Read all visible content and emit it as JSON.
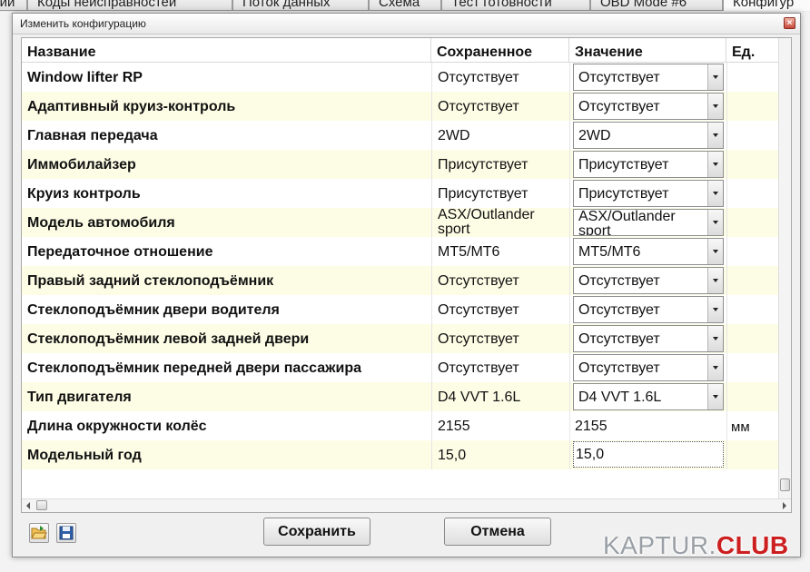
{
  "background_tabs": [
    "ции",
    "Коды неисправностей",
    "Поток данных",
    "Схема",
    "Тест готовности",
    "OBD Mode #6",
    "Конфигур"
  ],
  "dialog": {
    "title": "Изменить конфигурацию",
    "close_symbol": "×"
  },
  "table": {
    "columns": [
      "Название",
      "Сохраненное",
      "Значение",
      "Ед."
    ],
    "rows": [
      {
        "name": "Window lifter RP",
        "saved": "Отсутствует",
        "value": "Отсутствует",
        "unit": ""
      },
      {
        "name": "Адаптивный круиз-контроль",
        "saved": "Отсутствует",
        "value": "Отсутствует",
        "unit": ""
      },
      {
        "name": "Главная передача",
        "saved": "2WD",
        "value": "2WD",
        "unit": ""
      },
      {
        "name": "Иммобилайзер",
        "saved": "Присутствует",
        "value": "Присутствует",
        "unit": ""
      },
      {
        "name": "Круиз контроль",
        "saved": "Присутствует",
        "value": "Присутствует",
        "unit": ""
      },
      {
        "name": "Модель автомобиля",
        "saved": "ASX/Outlander sport",
        "value": "ASX/Outlander sport",
        "unit": ""
      },
      {
        "name": "Передаточное отношение",
        "saved": "MT5/MT6",
        "value": "MT5/MT6",
        "unit": ""
      },
      {
        "name": "Правый задний стеклоподъёмник",
        "saved": "Отсутствует",
        "value": "Отсутствует",
        "unit": ""
      },
      {
        "name": "Стеклоподъёмник двери водителя",
        "saved": "Отсутствует",
        "value": "Отсутствует",
        "unit": ""
      },
      {
        "name": "Стеклоподъёмник левой задней двери",
        "saved": "Отсутствует",
        "value": "Отсутствует",
        "unit": ""
      },
      {
        "name": "Стеклоподъёмник передней двери пассажира",
        "saved": "Отсутствует",
        "value": "Отсутствует",
        "unit": ""
      },
      {
        "name": "Тип двигателя",
        "saved": "D4 VVT 1.6L",
        "value": "D4 VVT 1.6L",
        "unit": ""
      },
      {
        "name": "Длина окружности колёс",
        "saved": "2155",
        "value": "2155",
        "unit": "мм"
      },
      {
        "name": "Модельный год",
        "saved": "15,0",
        "value": "15,0",
        "unit": ""
      }
    ]
  },
  "footer": {
    "save_label": "Сохранить",
    "cancel_label": "Отмена",
    "open_icon": "folder-open-icon",
    "save_icon": "floppy-disk-icon"
  },
  "watermark": {
    "main": "KAPTUR.",
    "tld": "CLUB"
  }
}
